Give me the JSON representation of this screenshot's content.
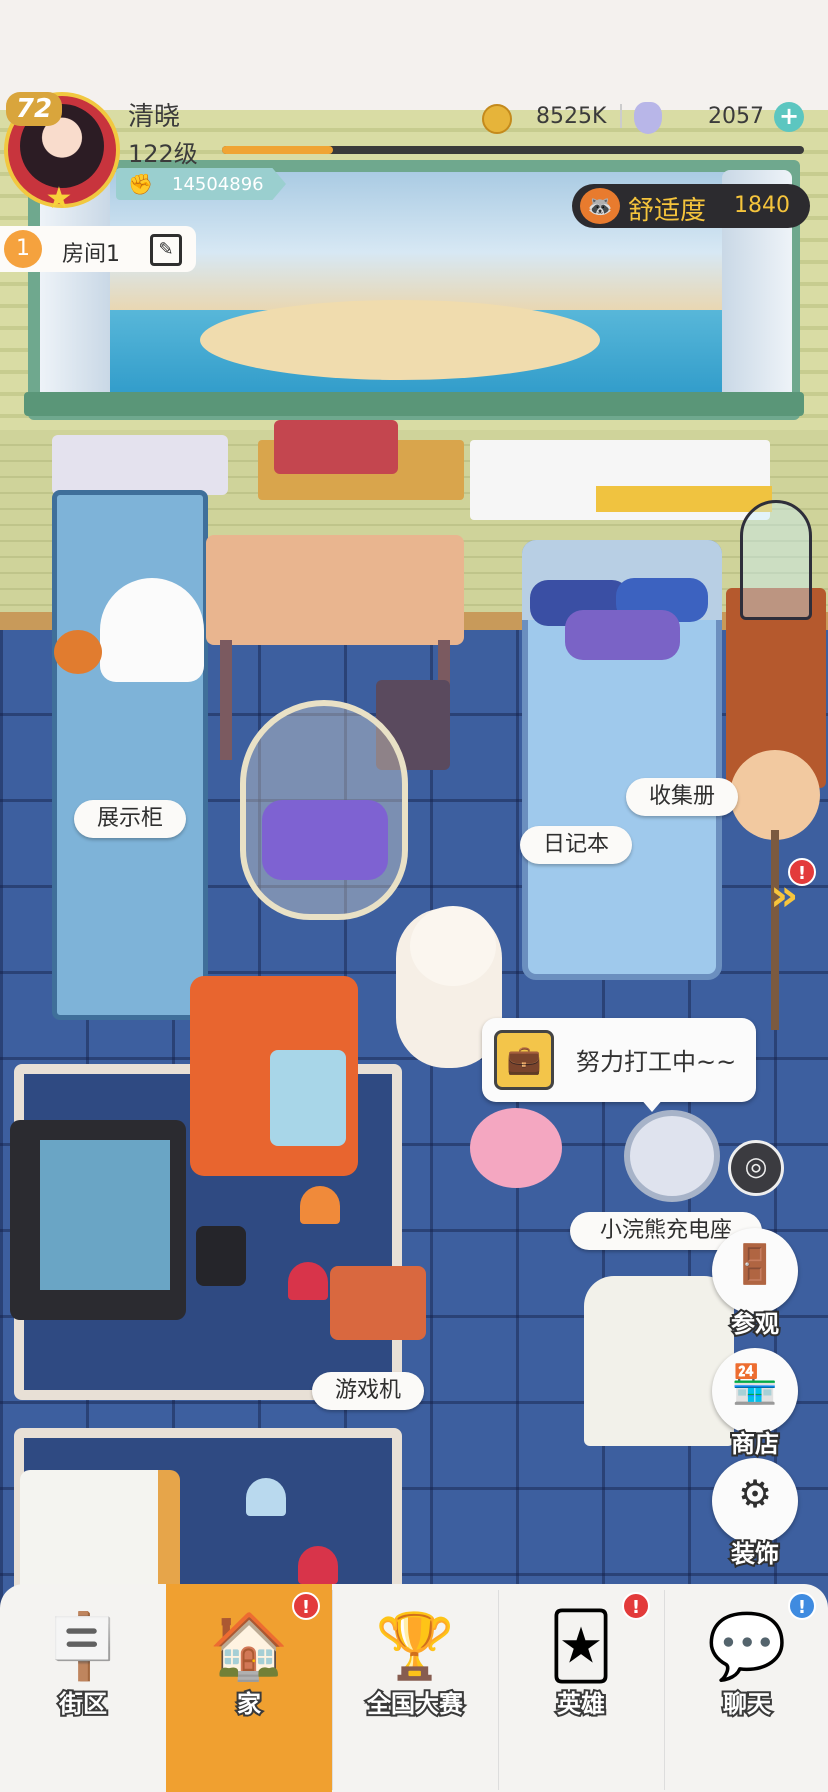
{
  "player": {
    "level_badge": "72",
    "name": "清晓",
    "level_text": "122级",
    "power": "14504896",
    "exp_fraction": 0.19
  },
  "currency": {
    "coins": "8525K",
    "gems": "2057",
    "plus": "+"
  },
  "comfort": {
    "label": "舒适度",
    "value": "1840"
  },
  "room": {
    "number": "1",
    "name": "房间1"
  },
  "labels": {
    "display_cabinet": "展示柜",
    "collection_book": "收集册",
    "diary": "日记本",
    "game_console": "游戏机",
    "charging_station": "小浣熊充电座"
  },
  "speech": {
    "text": "努力打工中~~"
  },
  "side_buttons": [
    {
      "label": "参观",
      "icon": "door-icon"
    },
    {
      "label": "商店",
      "icon": "shop-icon"
    },
    {
      "label": "装饰",
      "icon": "gear-icon"
    }
  ],
  "nav": [
    {
      "label": "街区",
      "icon": "signpost-icon",
      "active": false,
      "badge": ""
    },
    {
      "label": "家",
      "icon": "house-icon",
      "active": true,
      "badge": "!"
    },
    {
      "label": "全国大赛",
      "icon": "trophy-icon",
      "active": false,
      "badge": ""
    },
    {
      "label": "英雄",
      "icon": "cards-icon",
      "active": false,
      "badge": "!"
    },
    {
      "label": "聊天",
      "icon": "chat-bubble-icon",
      "active": false,
      "badge": "!"
    }
  ],
  "alerts": {
    "arrow_badge": "!"
  },
  "colors": {
    "accent_orange": "#f0a030",
    "floor_blue": "#3d5f9f",
    "comfort_gold": "#f5c43c",
    "alert_red": "#e33b3b",
    "chat_badge_blue": "#3f8be0"
  }
}
